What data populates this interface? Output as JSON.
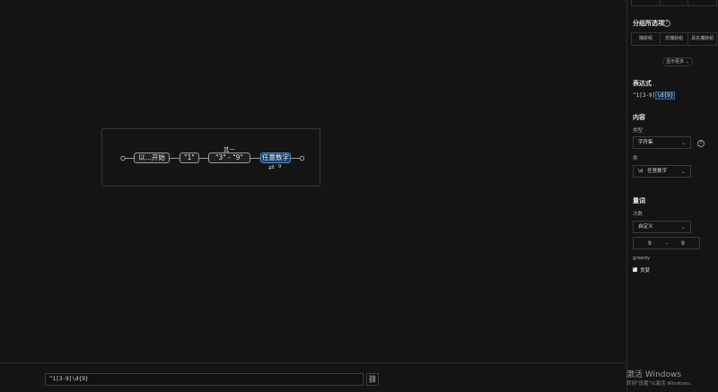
{
  "diagram": {
    "nodes": [
      "以...开始",
      "\"1\"",
      "\"3\" - \"9\"",
      "任意数字"
    ],
    "group_label": "其一",
    "repeat_count": "9"
  },
  "bottombar": {
    "regex_value": "^1[3-9]\\d{9}",
    "link_icon": "link-icon"
  },
  "panel": {
    "top_tabs": [
      "",
      "",
      ""
    ],
    "group_options": {
      "title": "分组所选项",
      "tabs": [
        "捕获组",
        "非捕获组",
        "具名捕获组"
      ],
      "show_more": "显示更多"
    },
    "expression": {
      "title": "表达式",
      "prefix": "^1[3-9]",
      "highlight": "\\d{9}"
    },
    "content": {
      "title": "内容",
      "type_label": "类型",
      "type_value": "字符集",
      "class_label": "类",
      "class_value_code": "\\d",
      "class_value_name": "任意数字"
    },
    "quantifier": {
      "title": "量词",
      "count_label": "次数",
      "count_value": "自定义",
      "range_min": "9",
      "range_sep": "-",
      "range_max": "9",
      "greedy_label": "greedy",
      "greedy_check_label": "贪婪",
      "greedy_checked": true
    }
  },
  "watermark": {
    "title": "激活 Windows",
    "subtitle": "转到\"设置\"以激活 Windows。"
  },
  "colors": {
    "accent": "#4c8fd0",
    "selected_node_bg": "#1d3f63",
    "background": "#151515"
  }
}
